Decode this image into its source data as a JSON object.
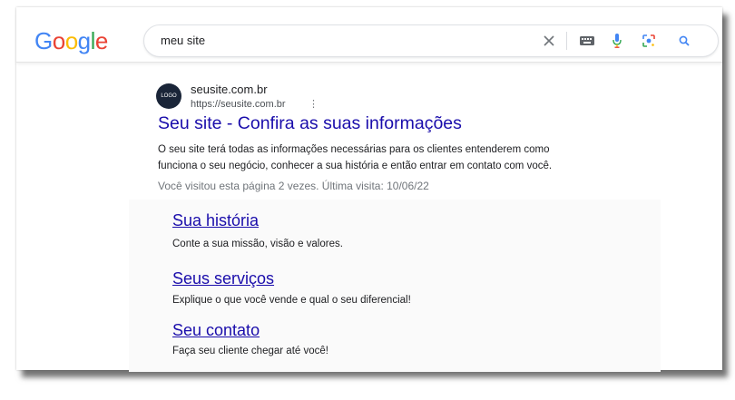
{
  "logo": {
    "text": "Google"
  },
  "search": {
    "value": "meu site"
  },
  "result": {
    "favicon_text": "LOGO",
    "site_name": "seusite.com.br",
    "url": "https://seusite.com.br",
    "title": "Seu site - Confira as suas informações",
    "snippet_line1": "O seu site terá todas as informações necessárias para os clientes entenderem como",
    "snippet_line2": "funciona o seu negócio, conhecer a sua história e então entrar em contato com você.",
    "visited": "Você visitou esta página 2 vezes. Última visita: 10/06/22"
  },
  "sitelinks": [
    {
      "title": "Sua história",
      "desc": "Conte a sua missão, visão e valores."
    },
    {
      "title": "Seus serviços",
      "desc": "Explique o que você vende e qual o seu diferencial!"
    },
    {
      "title": "Seu contato",
      "desc": "Faça seu cliente chegar até você!"
    }
  ],
  "colors": {
    "link": "#1a0dab",
    "google_blue": "#4285f4",
    "google_red": "#ea4335",
    "google_yellow": "#fbbc05",
    "google_green": "#34a853"
  },
  "icons": [
    "clear-icon",
    "keyboard-icon",
    "microphone-icon",
    "lens-icon",
    "search-icon"
  ]
}
